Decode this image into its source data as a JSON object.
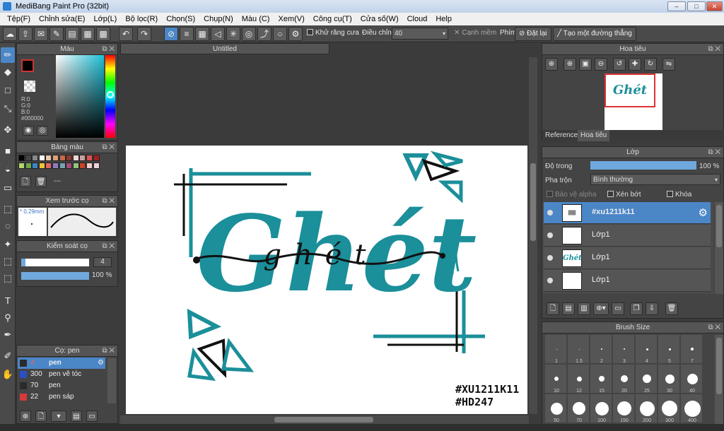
{
  "window": {
    "title": "MediBang Paint Pro (32bit)",
    "min": "–",
    "max": "□",
    "close": "✕"
  },
  "menu": [
    "Tệp(F)",
    "Chỉnh sửa(E)",
    "Lớp(L)",
    "Bộ lọc(R)",
    "Chọn(S)",
    "Chụp(N)",
    "Màu (C)",
    "Xem(V)",
    "Công cụ(T)",
    "Cửa số(W)",
    "Cloud",
    "Help"
  ],
  "toolbar": {
    "antialias_label": "Khử răng cưa",
    "adjust_label": "Điều chỉnh",
    "adjust_value": "40",
    "canh_mem_label": "Cạnh mềm",
    "phim_label": "Phím",
    "reset_label": "Đặt lại",
    "straight_label": "Tạo một đường thẳng"
  },
  "color_panel": {
    "title": "Màu",
    "r": "R:0",
    "g": "G:0",
    "b": "B:0",
    "hex": "#000000"
  },
  "swatch_panel": {
    "title": "Bảng màu",
    "dash": "---"
  },
  "brush_preview": {
    "title": "Xem trước cọ",
    "size": "* 0.29mm"
  },
  "brush_control": {
    "title": "Kiểm soát cọ",
    "size_value": "4",
    "opacity_value": "100 %",
    "size_fraction": 0.06,
    "opacity_fraction": 1.0
  },
  "brush_list": {
    "title": "Cọ: pen",
    "items": [
      {
        "value": "4",
        "name": "pen",
        "color": "#2b2b2b"
      },
      {
        "value": "300",
        "name": "pen vẽ tóc",
        "color": "#2b4fc4"
      },
      {
        "value": "70",
        "name": "pen",
        "color": "#2b2b2b"
      },
      {
        "value": "22",
        "name": "pen sáp",
        "color": "#d63a3a"
      }
    ]
  },
  "document": {
    "tab": "Untitled",
    "signature_line1": "#XU1211K11",
    "signature_line2": "#HD247",
    "art_text": "Ghét",
    "art_script": "ghét"
  },
  "navigator": {
    "title": "Hoa tiêu",
    "tab_reference": "Reference",
    "tab_navigator": "Hoa tiêu"
  },
  "layer_panel": {
    "title": "Lớp",
    "opacity_label": "Độ trong",
    "opacity_value": "100 %",
    "opacity_fraction": 1.0,
    "blend_label": "Pha trộn",
    "blend_value": "Bình thường",
    "protect_alpha": "Bảo vệ alpha",
    "clipping": "Xén bớt",
    "lock": "Khóa",
    "layers": [
      {
        "name": "#xu1211k11",
        "selected": true
      },
      {
        "name": "Lớp1",
        "selected": false
      },
      {
        "name": "Lớp1",
        "selected": false
      },
      {
        "name": "Lớp1",
        "selected": false
      }
    ]
  },
  "brush_size": {
    "title": "Brush Size",
    "sizes": [
      "1",
      "1.5",
      "2",
      "3",
      "4",
      "5",
      "7",
      "10",
      "12",
      "15",
      "20",
      "25",
      "30",
      "40",
      "50",
      "70",
      "100",
      "150",
      "200",
      "300",
      "400"
    ]
  },
  "colors": {
    "accent": "#4b86c7",
    "teal": "#1b8f9a",
    "panel": "#444444"
  }
}
